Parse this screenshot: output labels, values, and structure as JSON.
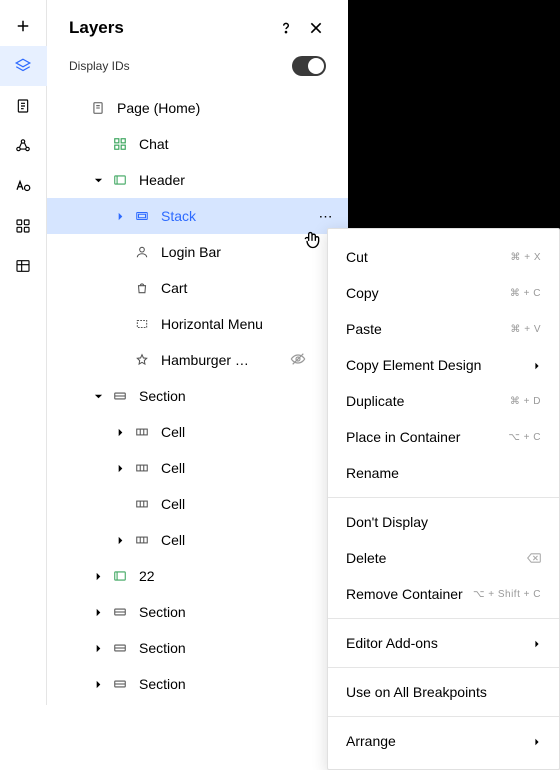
{
  "panel": {
    "title": "Layers",
    "display_ids_label": "Display IDs"
  },
  "tree": [
    {
      "id": "page",
      "label": "Page (Home)",
      "indent": 0,
      "chev": "",
      "icon": "page",
      "color": ""
    },
    {
      "id": "chat",
      "label": "Chat",
      "indent": 1,
      "chev": "",
      "icon": "grid4",
      "color": "green"
    },
    {
      "id": "header",
      "label": "Header",
      "indent": 1,
      "chev": "down",
      "icon": "container",
      "color": "green"
    },
    {
      "id": "stack",
      "label": "Stack",
      "indent": 2,
      "chev": "right",
      "icon": "stack",
      "color": "blue",
      "selected": true,
      "showDots": true
    },
    {
      "id": "loginbar",
      "label": "Login Bar",
      "indent": 2,
      "chev": "",
      "icon": "user",
      "color": ""
    },
    {
      "id": "cart",
      "label": "Cart",
      "indent": 2,
      "chev": "",
      "icon": "bag",
      "color": ""
    },
    {
      "id": "hmenu",
      "label": "Horizontal Menu",
      "indent": 2,
      "chev": "",
      "icon": "dashed",
      "color": ""
    },
    {
      "id": "hamburger",
      "label": "Hamburger …",
      "indent": 2,
      "chev": "",
      "icon": "star",
      "color": "",
      "hiddenEye": true
    },
    {
      "id": "section1",
      "label": "Section",
      "indent": 1,
      "chev": "down",
      "icon": "section",
      "color": ""
    },
    {
      "id": "cell1",
      "label": "Cell",
      "indent": 2,
      "chev": "right",
      "icon": "cell",
      "color": ""
    },
    {
      "id": "cell2",
      "label": "Cell",
      "indent": 2,
      "chev": "right",
      "icon": "cell",
      "color": ""
    },
    {
      "id": "cell3",
      "label": "Cell",
      "indent": 2,
      "chev": "",
      "icon": "cell",
      "color": ""
    },
    {
      "id": "cell4",
      "label": "Cell",
      "indent": 2,
      "chev": "right",
      "icon": "cell",
      "color": ""
    },
    {
      "id": "twentytwo",
      "label": "22",
      "indent": 1,
      "chev": "right",
      "icon": "container",
      "color": "green"
    },
    {
      "id": "section2",
      "label": "Section",
      "indent": 1,
      "chev": "right",
      "icon": "section",
      "color": ""
    },
    {
      "id": "section3",
      "label": "Section",
      "indent": 1,
      "chev": "right",
      "icon": "section",
      "color": ""
    },
    {
      "id": "section4",
      "label": "Section",
      "indent": 1,
      "chev": "right",
      "icon": "section",
      "color": ""
    }
  ],
  "menu": [
    {
      "type": "item",
      "label": "Cut",
      "shortcut": "⌘ + X"
    },
    {
      "type": "item",
      "label": "Copy",
      "shortcut": "⌘ + C"
    },
    {
      "type": "item",
      "label": "Paste",
      "shortcut": "⌘ + V"
    },
    {
      "type": "submenu",
      "label": "Copy Element Design"
    },
    {
      "type": "item",
      "label": "Duplicate",
      "shortcut": "⌘ + D"
    },
    {
      "type": "item",
      "label": "Place in Container",
      "shortcut": "⌥ + C"
    },
    {
      "type": "item",
      "label": "Rename"
    },
    {
      "type": "sep"
    },
    {
      "type": "item",
      "label": "Don't Display"
    },
    {
      "type": "delete",
      "label": "Delete"
    },
    {
      "type": "item",
      "label": "Remove Container",
      "shortcut": "⌥ + Shift + C"
    },
    {
      "type": "sep"
    },
    {
      "type": "submenu",
      "label": "Editor Add-ons"
    },
    {
      "type": "sep"
    },
    {
      "type": "item",
      "label": "Use on All Breakpoints"
    },
    {
      "type": "sep"
    },
    {
      "type": "submenu",
      "label": "Arrange"
    }
  ]
}
